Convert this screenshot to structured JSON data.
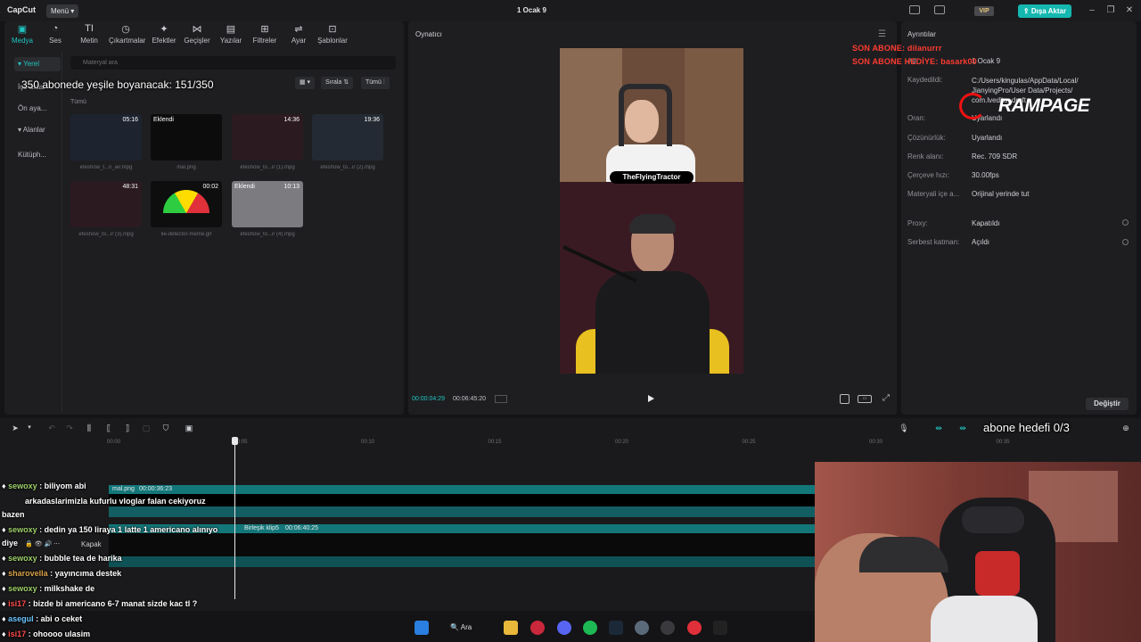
{
  "topbar": {
    "logo": "CapCut",
    "menu": "Menü",
    "title": "1 Ocak 9",
    "vip": "VIP",
    "export": "Dışa Aktar"
  },
  "tools": [
    {
      "label": "Medya",
      "icon": "media-icon"
    },
    {
      "label": "Ses",
      "icon": "audio-icon"
    },
    {
      "label": "Metin",
      "icon": "text-icon"
    },
    {
      "label": "Çıkartmalar",
      "icon": "sticker-icon"
    },
    {
      "label": "Efektler",
      "icon": "effects-icon"
    },
    {
      "label": "Geçişler",
      "icon": "transitions-icon"
    },
    {
      "label": "Yazılar",
      "icon": "captions-icon"
    },
    {
      "label": "Filtreler",
      "icon": "filters-icon"
    },
    {
      "label": "Ayar",
      "icon": "adjust-icon"
    },
    {
      "label": "Şablonlar",
      "icon": "templates-icon"
    }
  ],
  "side_nav": [
    "Yerel",
    "İçe aktar",
    "Ön aya...",
    "Alanlar",
    "Kütüph..."
  ],
  "media": {
    "search_placeholder": "Materyal ara",
    "sort": "Sırala",
    "filter": "Tümü",
    "all_label": "Tümü",
    "items": [
      {
        "name": "efeshow_t...n_air.mpg",
        "duration": "05:16",
        "badge": ""
      },
      {
        "name": "mal.png",
        "duration": "",
        "badge": "Eklendi"
      },
      {
        "name": "efeshow_to...ir (1).mpg",
        "duration": "14:36",
        "badge": ""
      },
      {
        "name": "efeshow_to...ir (2).mpg",
        "duration": "19:36",
        "badge": ""
      },
      {
        "name": "efeshow_to...ir (3).mpg",
        "duration": "48:31",
        "badge": ""
      },
      {
        "name": "lie-detector-meme.gif",
        "duration": "00:02",
        "badge": ""
      },
      {
        "name": "efeshow_to...ir (4).mpg",
        "duration": "10:13",
        "badge": "Eklendi"
      }
    ]
  },
  "player": {
    "title": "Oynatıcı",
    "tag": "TheFlyingTractor",
    "current_time": "00:00:04:29",
    "total_time": "00:06:45:20"
  },
  "details": {
    "title": "Ayrıntılar",
    "rows": [
      {
        "label": "Ad:",
        "value": "1 Ocak 9"
      },
      {
        "label": "Kaydedildi:",
        "value": "C:/Users/kingulas/AppData/Local/ JianyingPro/User Data/Projects/ com.lveditor.draft"
      },
      {
        "label": "Oran:",
        "value": "Uyarlandı"
      },
      {
        "label": "Çözünürlük:",
        "value": "Uyarlandı"
      },
      {
        "label": "Renk alanı:",
        "value": "Rec. 709 SDR"
      },
      {
        "label": "Çerçeve hızı:",
        "value": "30.00fps"
      },
      {
        "label": "Materyali içe a...",
        "value": "Orijinal yerinde tut"
      },
      {
        "label": "Proxy:",
        "value": "Kapatıldı"
      },
      {
        "label": "Serbest katman:",
        "value": "Açıldı"
      }
    ],
    "change": "Değiştir"
  },
  "overlays": {
    "last_sub": "SON ABONE: dilanurrr",
    "last_gift": "SON ABONE HEDİYE: basark00",
    "brand": "RAMPAGE",
    "sub_goal": "350 abonede yeşile boyanacak: 151/350",
    "sub_goal2": "abone hedefi 0/3"
  },
  "timeline": {
    "ticks": [
      "00:00",
      "00:05",
      "00:10",
      "00:15",
      "00:20",
      "00:25",
      "00:30",
      "00:35"
    ],
    "clip1": "mal.png",
    "clip1_dur": "00:00:36:23",
    "clip2": "Birleşik klip5",
    "clip2_dur": "00:06:40:25",
    "cover": "Kapak"
  },
  "chat": [
    {
      "user": "sewoxy",
      "text": ": biliyom abi"
    },
    {
      "user": "",
      "text": "arkadaslarimizla kufurlu vloglar falan cekiyoruz"
    },
    {
      "user": "",
      "text": "bazen"
    },
    {
      "user": "sewoxy",
      "text": ": dedin ya 150 liraya 1 latte 1 americano alınıyo"
    },
    {
      "user": "",
      "text": "diye"
    },
    {
      "user": "sewoxy",
      "text": ": bubble tea de harika"
    },
    {
      "user": "sharovella",
      "text": ": yayıncıma destek"
    },
    {
      "user": "sewoxy",
      "text": ": milkshake de"
    },
    {
      "user": "isi17",
      "text": ": bizde bi americano 6-7 manat sizde kac tl ?"
    },
    {
      "user": "asegul",
      "text": ": abi o ceket"
    },
    {
      "user": "isi17",
      "text": ": ohoooo ulasim"
    }
  ],
  "taskbar": {
    "search": "Ara"
  }
}
